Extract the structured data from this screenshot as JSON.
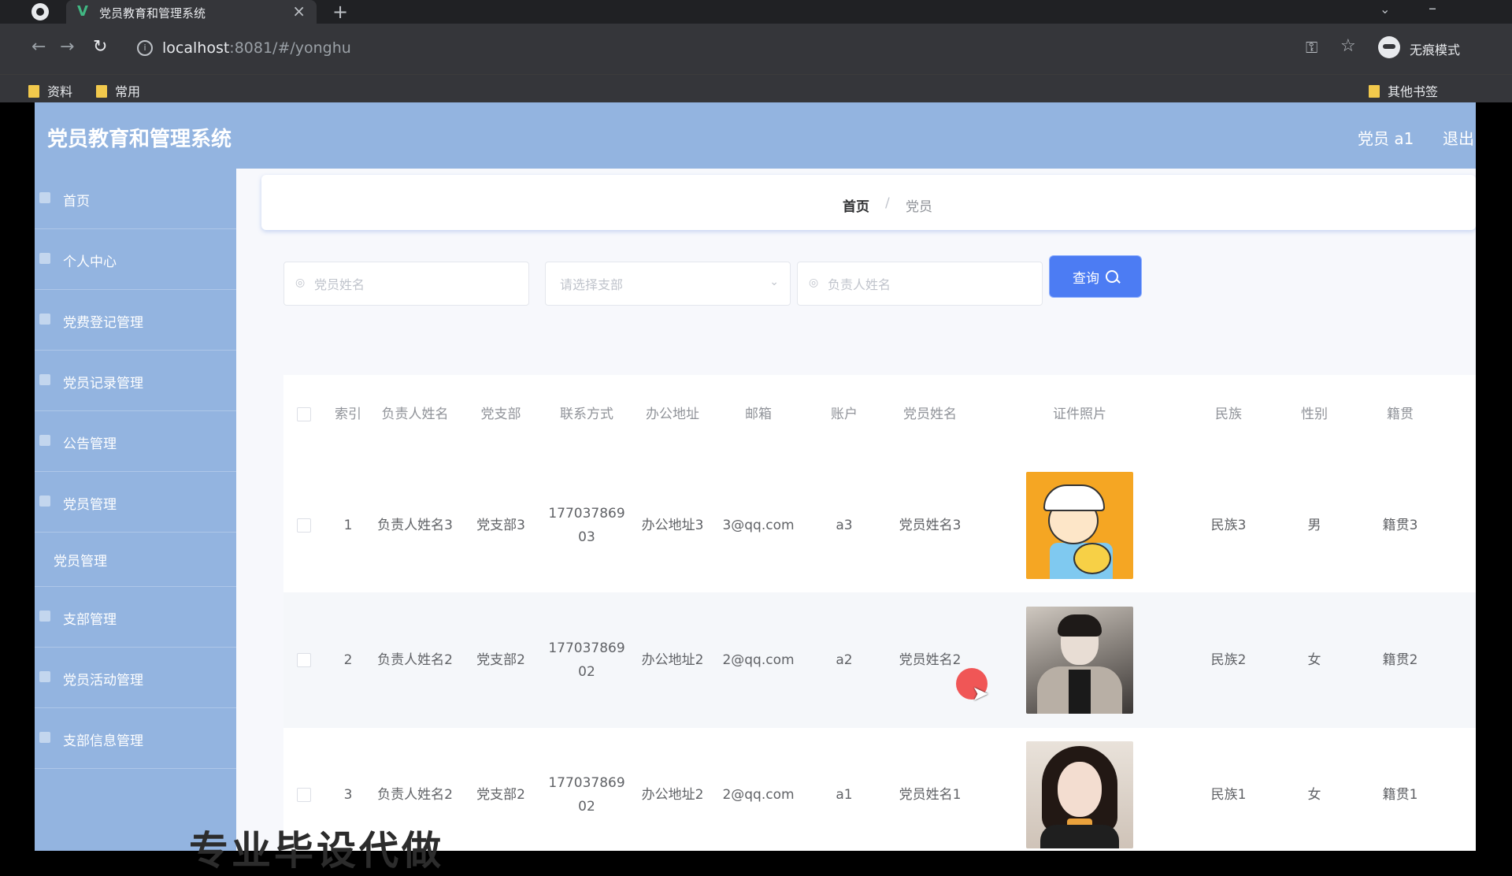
{
  "browser": {
    "tab_title": "党员教育和管理系统",
    "tab_favicon": "V",
    "tab_close": "×",
    "new_tab": "+",
    "url_host": "localhost",
    "url_rest": ":8081/#/yonghu",
    "incognito_label": "无痕模式",
    "bookmarks": [
      "资料",
      "常用"
    ],
    "other_bookmarks": "其他书签",
    "icons": [
      "back-icon",
      "forward-icon",
      "reload-icon",
      "info-icon",
      "key-icon",
      "star-icon",
      "incognito-icon",
      "folder-icon"
    ]
  },
  "header": {
    "title": "党员教育和管理系统",
    "user": "党员 a1",
    "logout": "退出"
  },
  "sidebar": {
    "items": [
      {
        "label": "首页"
      },
      {
        "label": "个人中心"
      },
      {
        "label": "党费登记管理"
      },
      {
        "label": "党员记录管理"
      },
      {
        "label": "公告管理"
      },
      {
        "label": "党员管理"
      },
      {
        "label": "党员管理",
        "sub": true
      },
      {
        "label": "支部管理"
      },
      {
        "label": "党员活动管理"
      },
      {
        "label": "支部信息管理"
      }
    ]
  },
  "breadcrumb": {
    "home": "首页",
    "separator": "/",
    "current": "党员"
  },
  "search": {
    "field1_placeholder": "党员姓名",
    "field2_placeholder": "请选择支部",
    "field3_placeholder": "负责人姓名",
    "button_label": "查询"
  },
  "table": {
    "columns": [
      "索引",
      "负责人姓名",
      "党支部",
      "联系方式",
      "办公地址",
      "邮箱",
      "账户",
      "党员姓名",
      "证件照片",
      "民族",
      "性别",
      "籍贯"
    ],
    "rows": [
      {
        "index": "1",
        "leader": "负责人姓名3",
        "branch": "党支部3",
        "phone": "17703786903",
        "office": "办公地址3",
        "email": "3@qq.com",
        "account": "a3",
        "name": "党员姓名3",
        "photo": "photo-cartoon",
        "ethnic": "民族3",
        "gender": "男",
        "origin": "籍贯3"
      },
      {
        "index": "2",
        "leader": "负责人姓名2",
        "branch": "党支部2",
        "phone": "17703786902",
        "office": "办公地址2",
        "email": "2@qq.com",
        "account": "a2",
        "name": "党员姓名2",
        "photo": "photo-gray",
        "ethnic": "民族2",
        "gender": "女",
        "origin": "籍贯2"
      },
      {
        "index": "3",
        "leader": "负责人姓名2",
        "branch": "党支部2",
        "phone": "17703786902",
        "office": "办公地址2",
        "email": "2@qq.com",
        "account": "a1",
        "name": "党员姓名1",
        "photo": "photo-girl",
        "ethnic": "民族1",
        "gender": "女",
        "origin": "籍贯1"
      }
    ]
  },
  "overlay_text": "专业毕设代做",
  "colors": {
    "header_bg": "#93b4e0",
    "primary_button": "#4c7cf3",
    "chrome_bg": "#202124"
  }
}
